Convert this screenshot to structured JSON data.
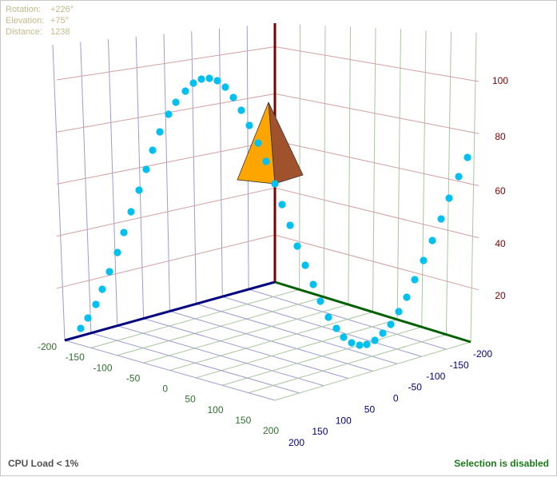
{
  "camera": {
    "rotation_label": "Rotation:",
    "rotation_value": "+226°",
    "elevation_label": "Elevation:",
    "elevation_value": "+75°",
    "distance_label": "Distance:",
    "distance_value": "1238"
  },
  "status": {
    "cpu": "CPU Load < 1%",
    "selection": "Selection is disabled"
  },
  "colors": {
    "axis_x": "#000080",
    "axis_y": "#800000",
    "axis_z": "#006000",
    "grid_blue": "#9c9cd0",
    "grid_red": "#d0a0a0",
    "grid_green": "#a8c8a0",
    "points": "#00c0f0",
    "pyramid_front": "#ffa500",
    "pyramid_side": "#a0522d"
  },
  "chart_data": {
    "type": "scatter",
    "title": "",
    "x_axis": {
      "ticks": [
        "-200",
        "-150",
        "-100",
        "-50",
        "0",
        "50",
        "100",
        "150",
        "200"
      ]
    },
    "z_axis": {
      "ticks": [
        "-200",
        "-150",
        "-100",
        "-50",
        "0",
        "50",
        "100",
        "150",
        "200"
      ]
    },
    "y_axis": {
      "ticks": [
        "20",
        "40",
        "60",
        "80",
        "100"
      ],
      "range": [
        0,
        110
      ]
    },
    "grid": true
  }
}
